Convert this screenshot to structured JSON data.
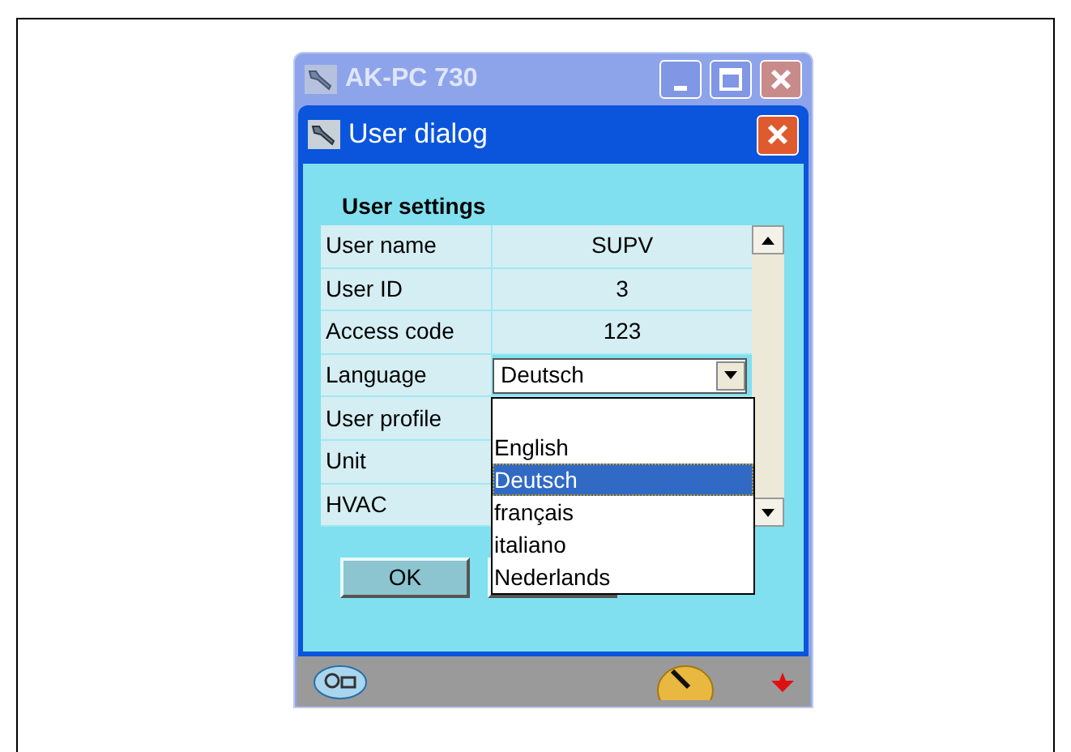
{
  "back_window": {
    "title": "AK-PC 730"
  },
  "dialog": {
    "title": "User dialog",
    "section": "User settings",
    "rows": [
      {
        "label": "User name",
        "kind": "text",
        "value": "SUPV"
      },
      {
        "label": "User ID",
        "kind": "text",
        "value": "3"
      },
      {
        "label": "Access code",
        "kind": "text",
        "value": "123"
      },
      {
        "label": "Language",
        "kind": "dropdown",
        "value": "Deutsch",
        "expanded": true,
        "options": [
          {
            "kind": "blank"
          },
          {
            "kind": "item",
            "label": "English",
            "selected": false
          },
          {
            "kind": "item",
            "label": "Deutsch",
            "selected": true
          },
          {
            "kind": "item",
            "label": "français",
            "selected": false
          },
          {
            "kind": "item",
            "label": "italiano",
            "selected": false
          },
          {
            "kind": "item",
            "label": "Nederlands",
            "selected": false
          }
        ]
      },
      {
        "label": "User profile",
        "kind": "text"
      },
      {
        "label": "Unit",
        "kind": "text"
      },
      {
        "label": "HVAC",
        "kind": "text"
      }
    ],
    "buttons": [
      {
        "kind": "normal",
        "label": "OK"
      },
      {
        "kind": "covered"
      }
    ]
  }
}
